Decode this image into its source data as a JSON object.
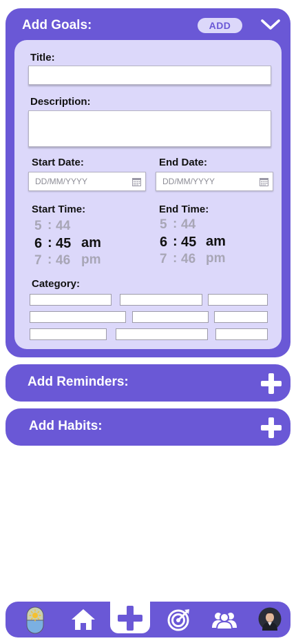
{
  "goals": {
    "header_title": "Add Goals:",
    "add_label": "ADD",
    "title_label": "Title:",
    "title_value": "",
    "description_label": "Description:",
    "description_value": "",
    "start_date_label": "Start Date:",
    "end_date_label": "End Date:",
    "date_placeholder": "DD/MM/YYYY",
    "start_time_label": "Start Time:",
    "end_time_label": "End Time:",
    "start_time": {
      "prev": {
        "h": "5",
        "m": "44"
      },
      "current": {
        "h": "6",
        "m": "45"
      },
      "next": {
        "h": "7",
        "m": "46"
      },
      "period_selected": "am",
      "period_other": "pm"
    },
    "end_time": {
      "prev": {
        "h": "5",
        "m": "44"
      },
      "current": {
        "h": "6",
        "m": "45"
      },
      "next": {
        "h": "7",
        "m": "46"
      },
      "period_selected": "am",
      "period_other": "pm"
    },
    "separator": ":",
    "category_label": "Category:"
  },
  "reminders": {
    "title": "Add Reminders:"
  },
  "habits": {
    "title": "Add Habits:"
  },
  "nav": {
    "items": [
      "pill-icon",
      "home-icon",
      "plus-icon",
      "target-icon",
      "users-icon",
      "profile-avatar"
    ],
    "active": "plus-icon"
  },
  "colors": {
    "primary": "#6a58d6",
    "card": "#dcd8fa",
    "dim_text": "#a8a6b6"
  }
}
